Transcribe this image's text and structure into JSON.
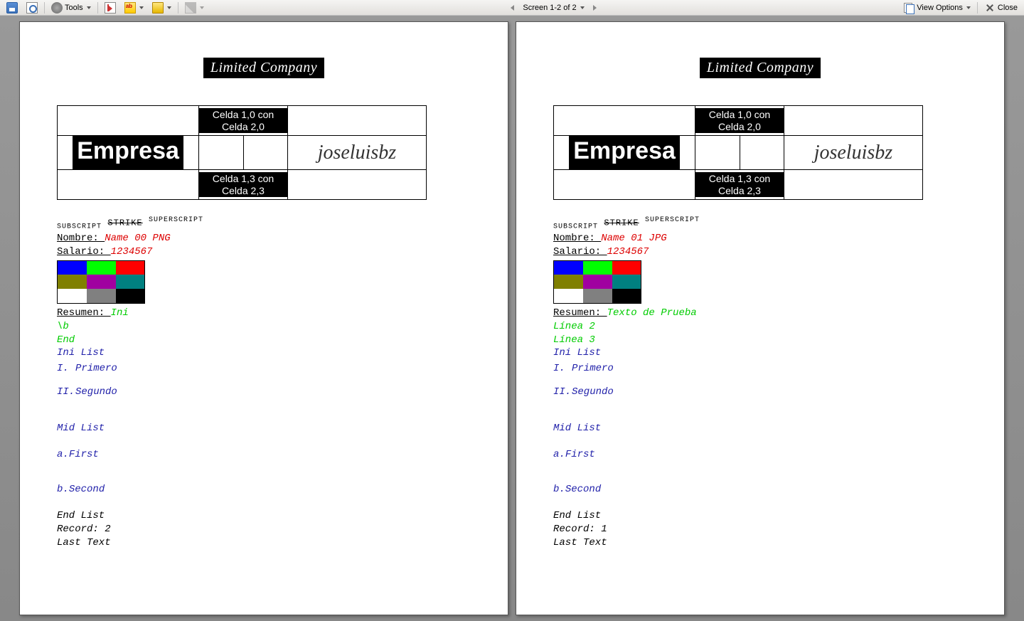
{
  "toolbar": {
    "tools_label": "Tools",
    "screen_label": "Screen 1-2 of 2",
    "view_options_label": "View Options",
    "close_label": "Close"
  },
  "banner_text": "Limited Company",
  "table_cells": {
    "c10": "Celda 1,0 con Celda 2,0",
    "empresa": "Empresa",
    "signature": "joseluisbz",
    "c13": "Celda 1,3 con Celda 2,3"
  },
  "labels": {
    "subscript": "SUBSCRIPT",
    "strike": "STRIKE",
    "superscript": "SUPERSCRIPT",
    "nombre": "Nombre: ",
    "salario": "Salario: ",
    "resumen": "Resumen: ",
    "ini_list": "Ini List",
    "mid_list": "Mid List",
    "end_list": "End List",
    "record": "Record: ",
    "last_text": "Last Text",
    "primero": "Primero",
    "segundo": "Segundo",
    "first": "First",
    "second": "Second",
    "roman1": "I.",
    "roman2": "II.",
    "a": "a.",
    "b": "b."
  },
  "color_grid": [
    [
      "#0000ff",
      "#00ff00",
      "#ff0000"
    ],
    [
      "#808000",
      "#a000a0",
      "#008080"
    ],
    [
      "#ffffff",
      "#808080",
      "#000000"
    ]
  ],
  "pages": [
    {
      "name_value": "Name 00 PNG",
      "salary_value": "1234567",
      "resumen_value": "Ini",
      "resumen_extra": [
        "\\b",
        "End"
      ],
      "record_value": "2"
    },
    {
      "name_value": "Name 01 JPG",
      "salary_value": "1234567",
      "resumen_value": "Texto de Prueba",
      "resumen_extra": [
        "Línea 2",
        "Línea 3"
      ],
      "record_value": "1"
    }
  ]
}
